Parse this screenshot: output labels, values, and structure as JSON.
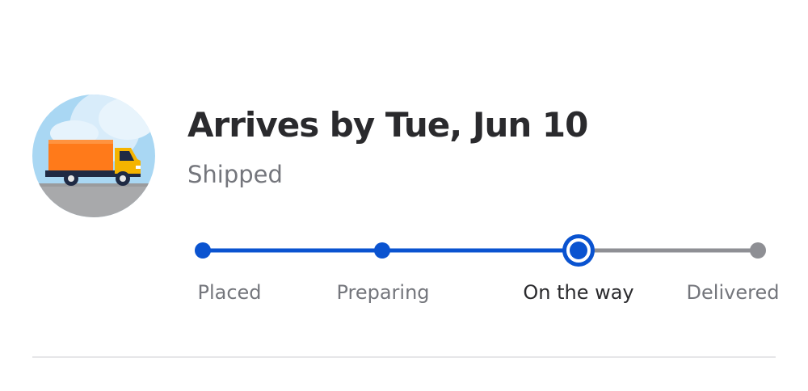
{
  "delivery": {
    "title": "Arrives by Tue, Jun 10",
    "status": "Shipped",
    "illustration_icon": "delivery-truck-icon"
  },
  "tracker": {
    "current_step_index": 2,
    "steps": [
      {
        "label": "Placed",
        "state": "complete"
      },
      {
        "label": "Preparing",
        "state": "complete"
      },
      {
        "label": "On the way",
        "state": "current"
      },
      {
        "label": "Delivered",
        "state": "upcoming"
      }
    ]
  },
  "colors": {
    "progress_active": "#0a53d0",
    "progress_inactive": "#8e8f94",
    "title_text": "#2a2a2d",
    "muted_text": "#74767c",
    "truck_cargo": "#ff7a1a",
    "truck_cab": "#f5b400",
    "sky": "#cfe7f8",
    "road": "#a8a9ab"
  }
}
